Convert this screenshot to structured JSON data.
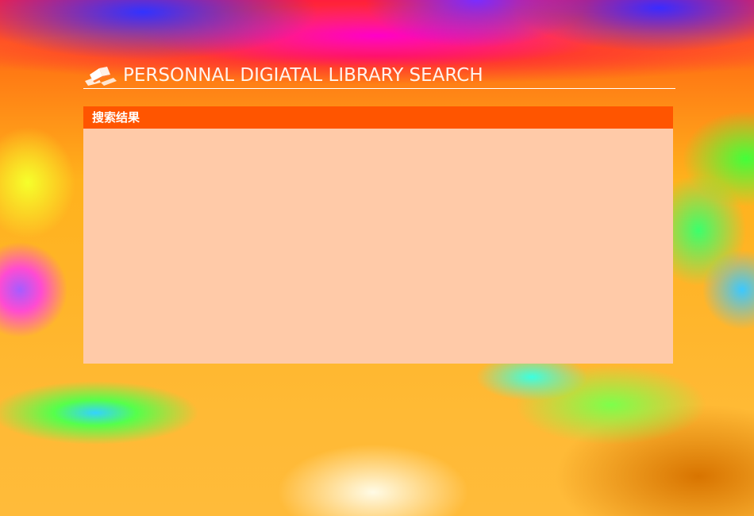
{
  "header": {
    "logo_icon": "open-book-icon",
    "title": "PERSONNAL DIGIATAL LIBRARY SEARCH"
  },
  "results_panel": {
    "title": "搜索结果",
    "results": []
  },
  "colors": {
    "panel_header": "#ff5500",
    "panel_body": "#ffcaa8",
    "header_text": "#ffffff"
  }
}
